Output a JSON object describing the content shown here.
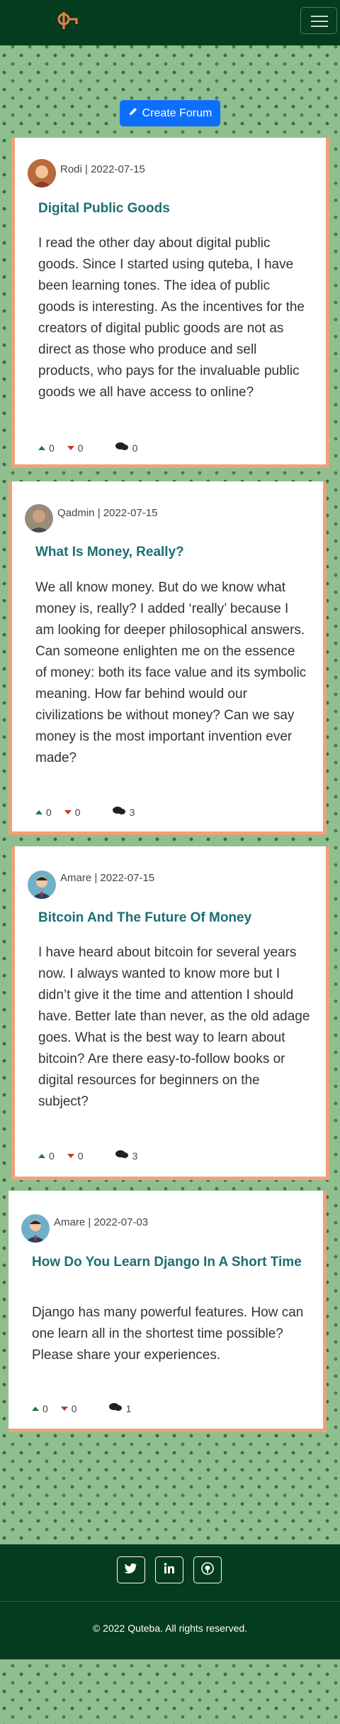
{
  "navbar": {
    "logo_icon": "logo-icon",
    "menu_icon": "hamburger-icon"
  },
  "create_forum": {
    "label": "Create Forum",
    "icon": "pencil-icon"
  },
  "posts": [
    {
      "author": "Rodi | 2022-07-15",
      "title": "Digital Public Goods",
      "body": "I read the other day about digital public goods. Since I started using quteba, I have been learning tones. The idea of public goods is interesting. As the incentives for the creators of digital public goods are not as direct as those who produce and sell products, who pays for the invaluable public goods we all have access to online?",
      "upvotes": "0",
      "downvotes": "0",
      "comments": "0"
    },
    {
      "author": "Qadmin | 2022-07-15",
      "title": "What Is Money, Really?",
      "body": "We all know money. But do we know what money is, really? I added ‘really’ because I am looking for deeper philosophical answers. Can someone enlighten me on the essence of money: both its face value and its symbolic meaning. How far behind would our civilizations be without money? Can we say money is the most important invention ever made?",
      "upvotes": "0",
      "downvotes": "0",
      "comments": "3"
    },
    {
      "author": "Amare | 2022-07-15",
      "title": "Bitcoin And The Future Of Money",
      "body": "I have heard about bitcoin for several years now. I always wanted to know more but I didn’t give it the time and attention I should have. Better late than never, as the old adage goes. What is the best way to learn about bitcoin? Are there easy-to-follow books or digital resources for beginners on the subject?",
      "upvotes": "0",
      "downvotes": "0",
      "comments": "3"
    },
    {
      "author": "Amare | 2022-07-03",
      "title": "How Do You Learn Django In A Short Time",
      "body": "Django has many powerful features. How can one learn all in the shortest time possible? Please share your experiences.",
      "upvotes": "0",
      "downvotes": "0",
      "comments": "1"
    }
  ],
  "footer": {
    "social": [
      "twitter-icon",
      "linkedin-icon",
      "github-icon"
    ],
    "copyright": "2022 Quteba. All rights reserved."
  },
  "colors": {
    "navbar": "#053b1e",
    "accent": "#f0a07a",
    "title": "#1b6f72",
    "button": "#0d6efd"
  }
}
